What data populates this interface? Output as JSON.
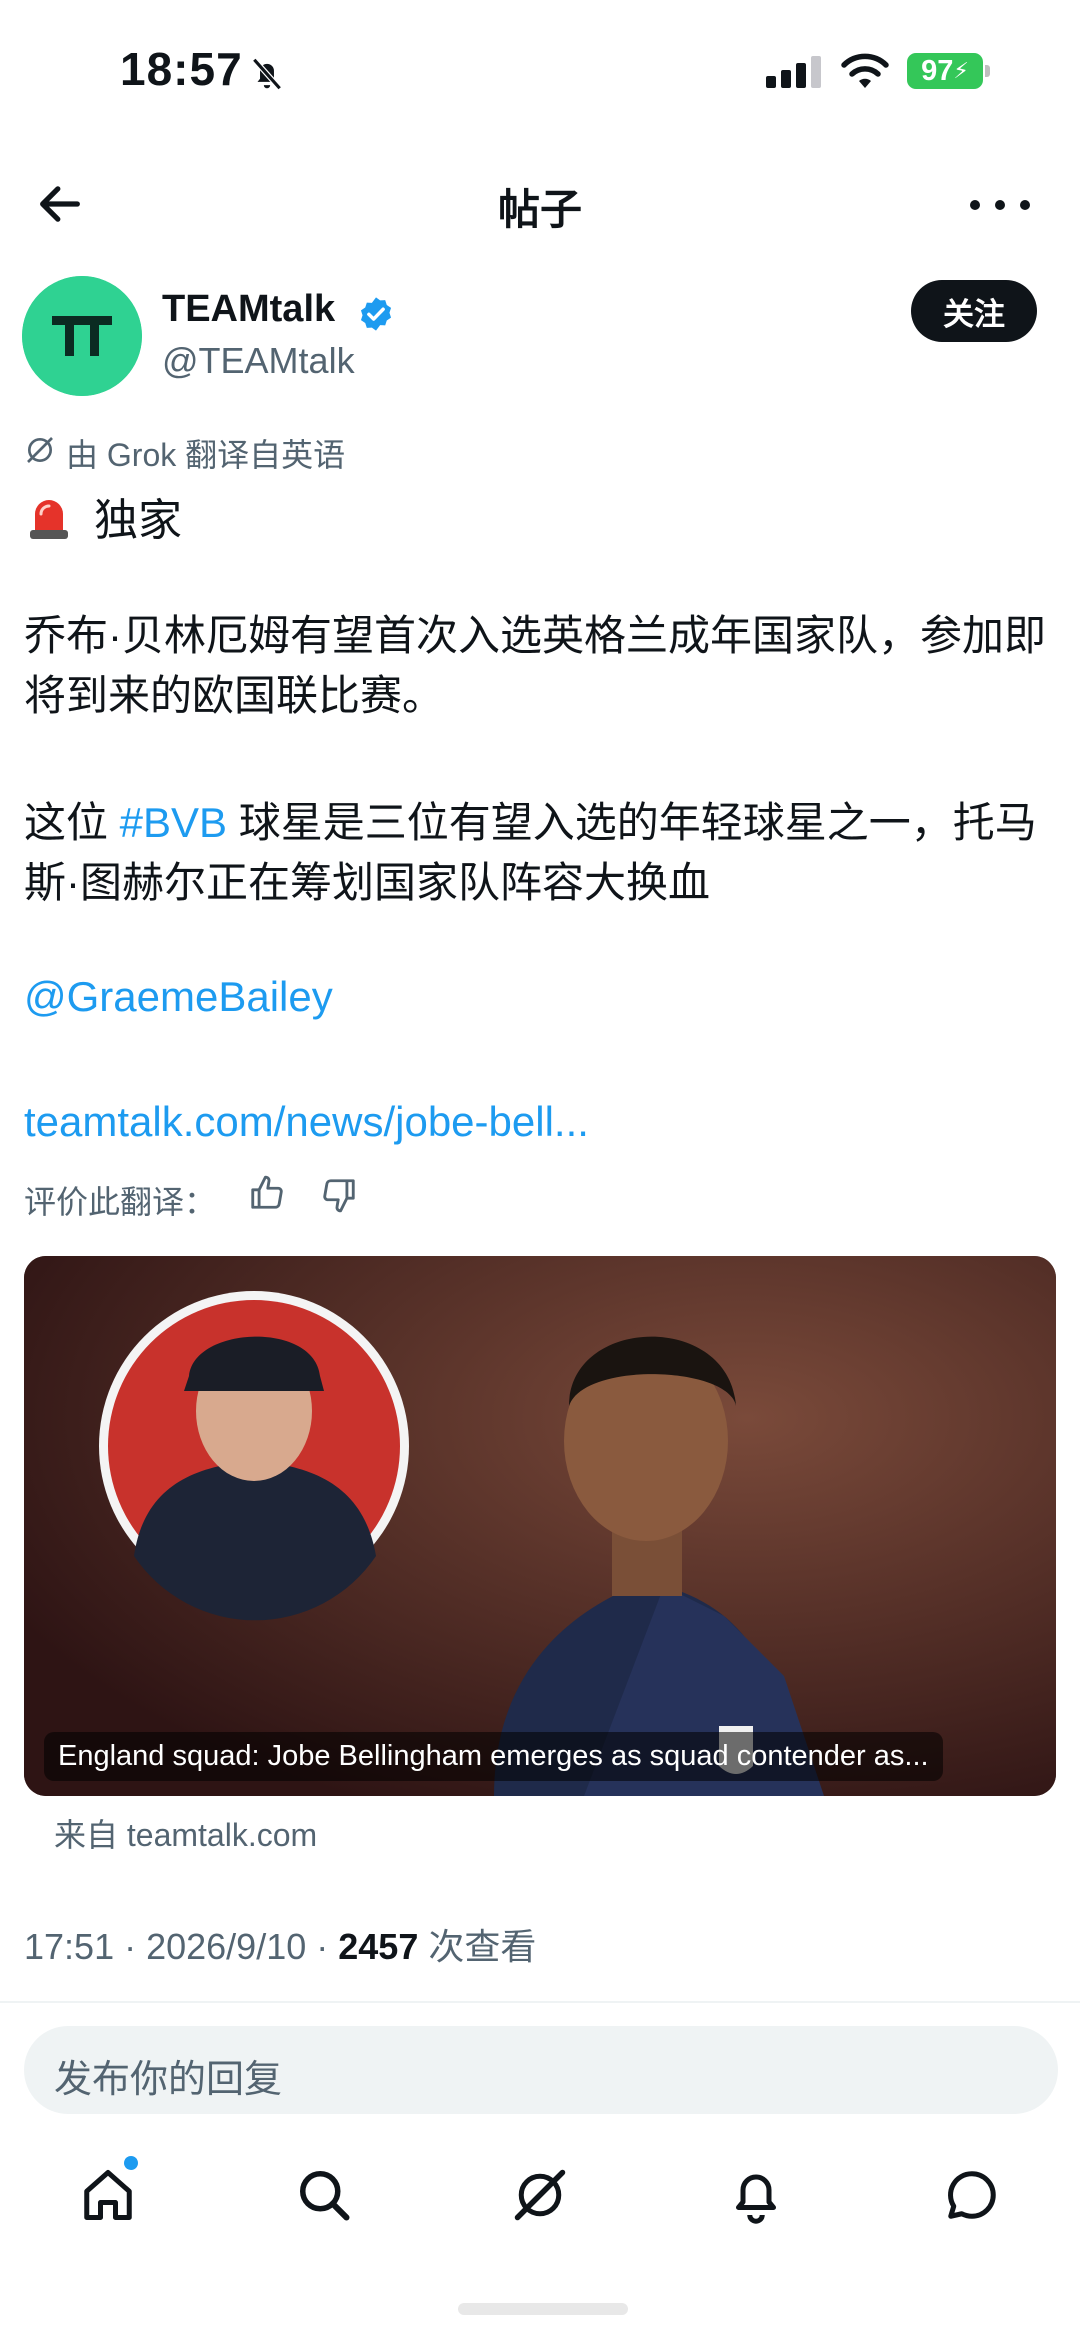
{
  "status_bar": {
    "time": "18:57",
    "battery": "97"
  },
  "header": {
    "title": "帖子"
  },
  "author": {
    "avatar_text": "TT",
    "name": "TEAMtalk",
    "handle": "@TEAMtalk",
    "follow_label": "关注"
  },
  "post": {
    "translated_notice": "由 Grok 翻译自英语",
    "exclusive": "独家",
    "para1": "乔布·贝林厄姆有望首次入选英格兰成年国家队，参加即将到来的欧国联比赛。",
    "para2_prefix": "这位 ",
    "hashtag": "#BVB",
    "para2_suffix": " 球星是三位有望入选的年轻球星之一，托马斯·图赫尔正在筹划国家队阵容大换血",
    "mention": "@GraemeBailey",
    "url": "teamtalk.com/news/jobe-bell...",
    "rate_label": "评价此翻译："
  },
  "card": {
    "caption": "England squad: Jobe Bellingham emerges as squad contender as...",
    "source": "来自 teamtalk.com"
  },
  "meta": {
    "time": "17:51",
    "date": "2026/9/10",
    "views": "2457",
    "views_label": "次查看"
  },
  "reply": {
    "placeholder": "发布你的回复"
  },
  "tabs": [
    "home-icon",
    "search-icon",
    "grok-icon",
    "notifications-icon",
    "messages-icon"
  ],
  "colors": {
    "accent": "#1d9bf0",
    "avatar_bg": "#2fd292",
    "battery": "#34c759"
  }
}
